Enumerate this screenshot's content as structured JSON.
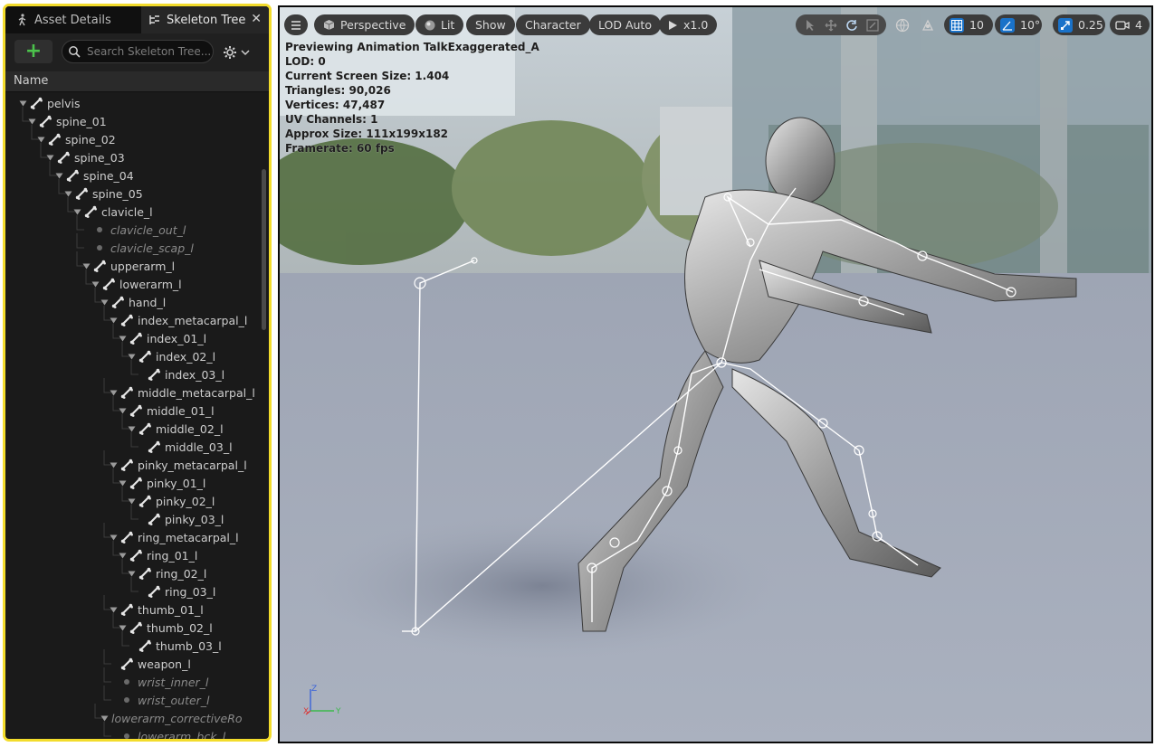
{
  "panel": {
    "tabs": [
      {
        "label": "Asset Details",
        "icon": "walking-person-icon"
      },
      {
        "label": "Skeleton Tree",
        "icon": "skeleton-tree-icon"
      }
    ],
    "close_glyph": "✕",
    "add_glyph": "+",
    "search_placeholder": "Search Skeleton Tree...",
    "column_header": "Name"
  },
  "tree": [
    {
      "label": "pelvis",
      "depth": 0,
      "type": "bone"
    },
    {
      "label": "spine_01",
      "depth": 1,
      "type": "bone"
    },
    {
      "label": "spine_02",
      "depth": 2,
      "type": "bone"
    },
    {
      "label": "spine_03",
      "depth": 3,
      "type": "bone"
    },
    {
      "label": "spine_04",
      "depth": 4,
      "type": "bone"
    },
    {
      "label": "spine_05",
      "depth": 5,
      "type": "bone"
    },
    {
      "label": "clavicle_l",
      "depth": 6,
      "type": "bone"
    },
    {
      "label": "clavicle_out_l",
      "depth": 7,
      "type": "virtual"
    },
    {
      "label": "clavicle_scap_l",
      "depth": 7,
      "type": "virtual"
    },
    {
      "label": "upperarm_l",
      "depth": 7,
      "type": "bone"
    },
    {
      "label": "lowerarm_l",
      "depth": 8,
      "type": "bone"
    },
    {
      "label": "hand_l",
      "depth": 9,
      "type": "bone"
    },
    {
      "label": "index_metacarpal_l",
      "depth": 10,
      "type": "bone"
    },
    {
      "label": "index_01_l",
      "depth": 11,
      "type": "bone"
    },
    {
      "label": "index_02_l",
      "depth": 12,
      "type": "bone"
    },
    {
      "label": "index_03_l",
      "depth": 13,
      "type": "leaf"
    },
    {
      "label": "middle_metacarpal_l",
      "depth": 10,
      "type": "bone"
    },
    {
      "label": "middle_01_l",
      "depth": 11,
      "type": "bone"
    },
    {
      "label": "middle_02_l",
      "depth": 12,
      "type": "bone"
    },
    {
      "label": "middle_03_l",
      "depth": 13,
      "type": "leaf"
    },
    {
      "label": "pinky_metacarpal_l",
      "depth": 10,
      "type": "bone"
    },
    {
      "label": "pinky_01_l",
      "depth": 11,
      "type": "bone"
    },
    {
      "label": "pinky_02_l",
      "depth": 12,
      "type": "bone"
    },
    {
      "label": "pinky_03_l",
      "depth": 13,
      "type": "leaf"
    },
    {
      "label": "ring_metacarpal_l",
      "depth": 10,
      "type": "bone"
    },
    {
      "label": "ring_01_l",
      "depth": 11,
      "type": "bone"
    },
    {
      "label": "ring_02_l",
      "depth": 12,
      "type": "bone"
    },
    {
      "label": "ring_03_l",
      "depth": 13,
      "type": "leaf"
    },
    {
      "label": "thumb_01_l",
      "depth": 10,
      "type": "bone"
    },
    {
      "label": "thumb_02_l",
      "depth": 11,
      "type": "bone"
    },
    {
      "label": "thumb_03_l",
      "depth": 12,
      "type": "leaf"
    },
    {
      "label": "weapon_l",
      "depth": 10,
      "type": "leaf"
    },
    {
      "label": "wrist_inner_l",
      "depth": 10,
      "type": "virtual"
    },
    {
      "label": "wrist_outer_l",
      "depth": 10,
      "type": "virtual"
    },
    {
      "label": "lowerarm_correctiveRo",
      "depth": 9,
      "type": "virtual-parent"
    },
    {
      "label": "lowerarm_bck_l",
      "depth": 10,
      "type": "virtual"
    }
  ],
  "viewport": {
    "toolbar": {
      "menu_icon": "hamburger-icon",
      "perspective": "Perspective",
      "lit": "Lit",
      "show": "Show",
      "character": "Character",
      "lod": "LOD Auto",
      "play_speed": "x1.0",
      "grid_snap": "10",
      "angle_snap": "10°",
      "scale_snap": "0.25",
      "camera_speed": "4"
    },
    "stats": [
      "Previewing Animation TalkExaggerated_A",
      "LOD: 0",
      "Current Screen Size: 1.404",
      "Triangles: 90,026",
      "Vertices: 47,487",
      "UV Channels: 1",
      "Approx Size: 111x199x182",
      "Framerate: 60 fps"
    ],
    "axis_labels": {
      "z": "Z",
      "y": "Y",
      "x": "X"
    }
  },
  "colors": {
    "highlight_frame": "#f3dc2c",
    "accent_blue": "#1a72c9",
    "panel_bg": "#1a1a1a"
  }
}
